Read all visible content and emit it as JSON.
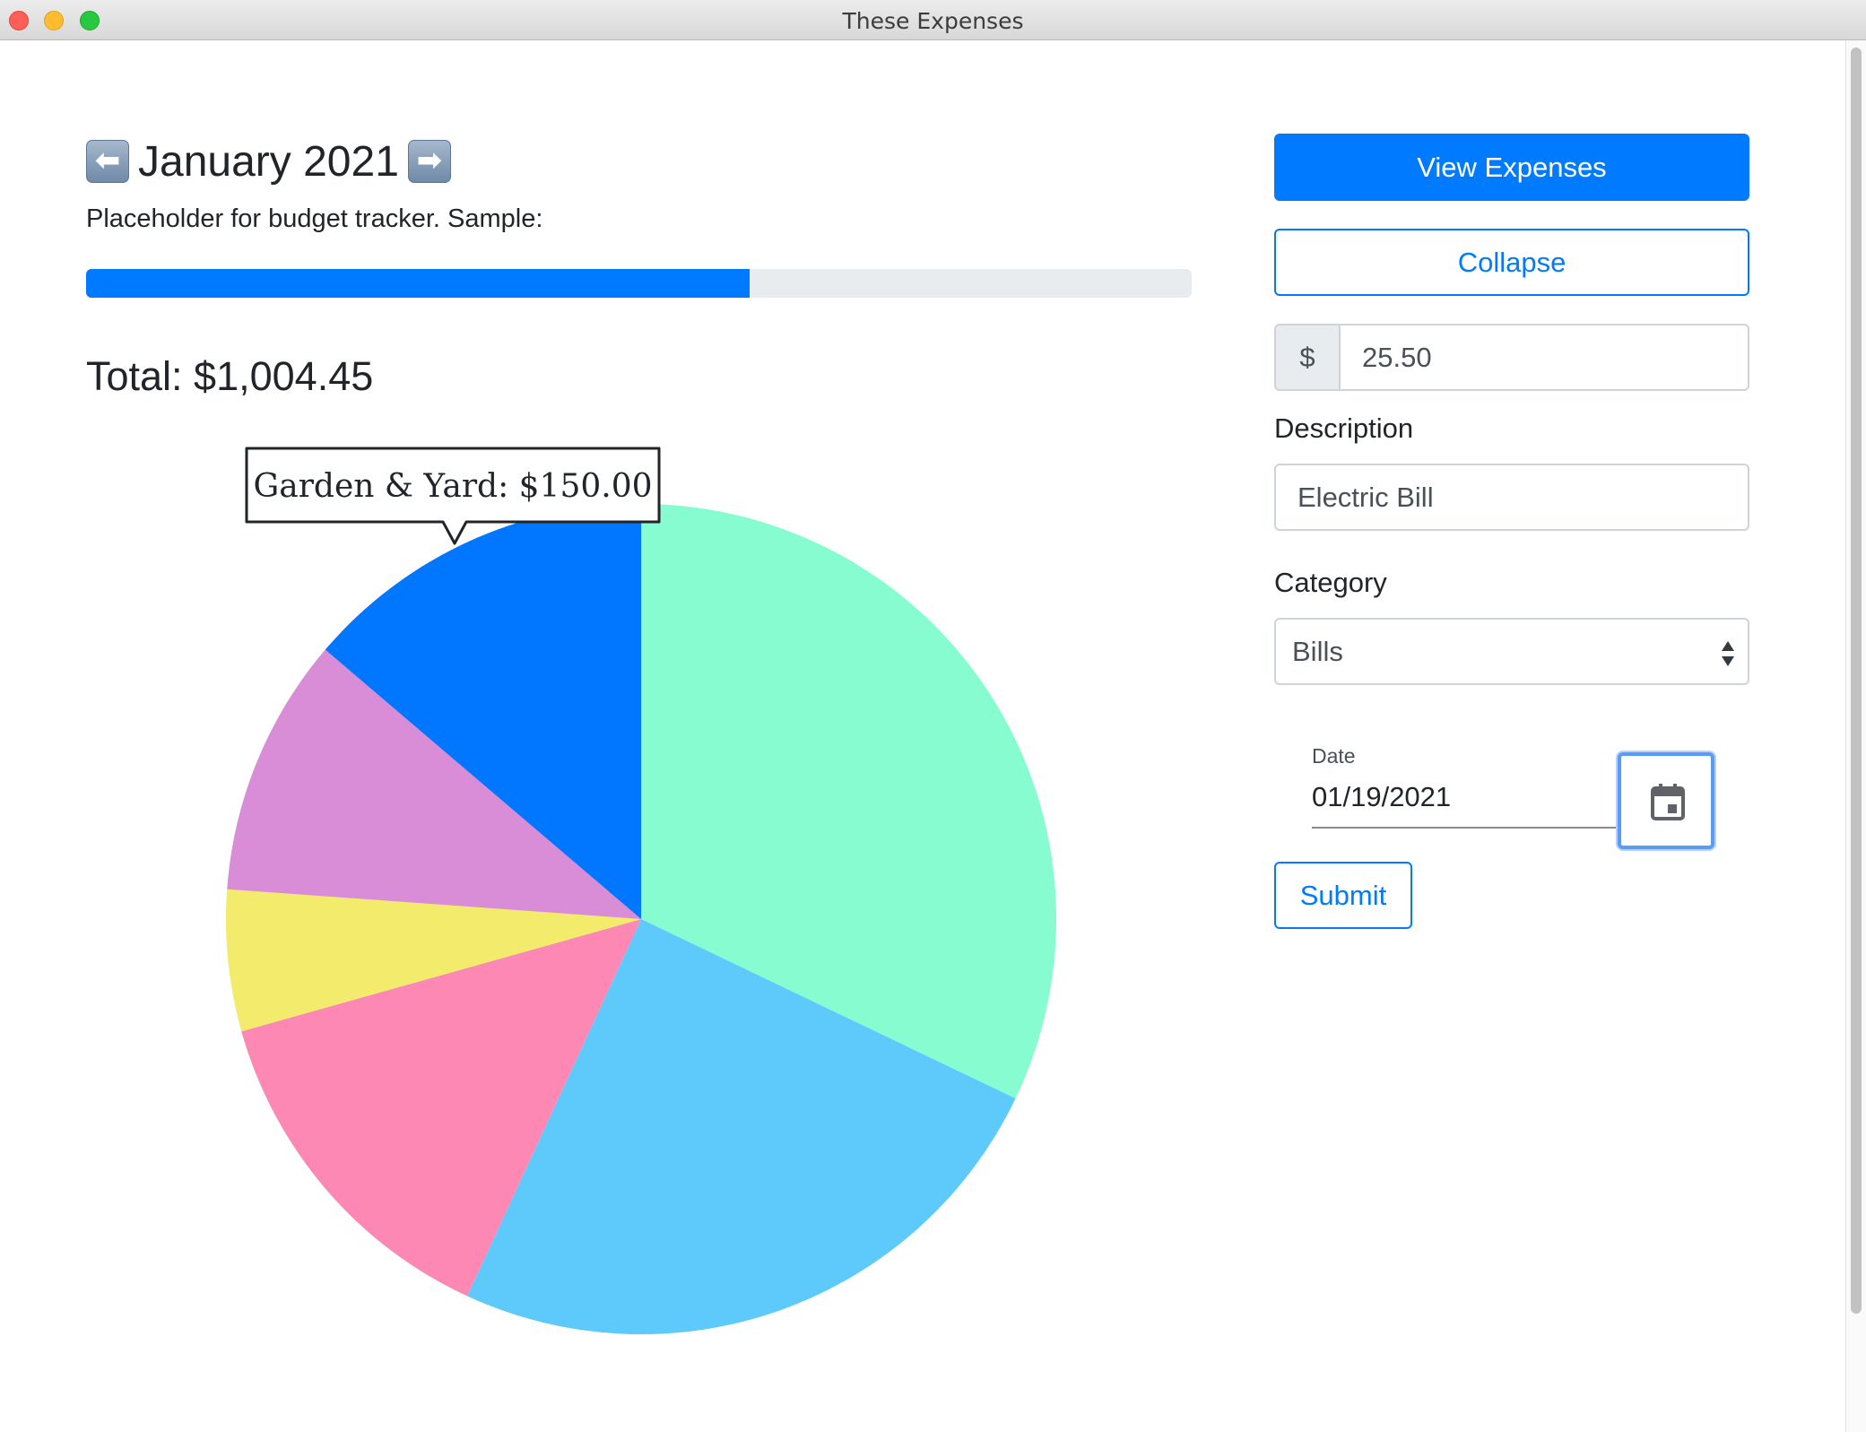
{
  "window": {
    "title": "These Expenses"
  },
  "header": {
    "prev_icon": "left-arrow-icon",
    "next_icon": "right-arrow-icon",
    "prev_glyph": "⬅",
    "next_glyph": "➡",
    "month": "January 2021"
  },
  "budget": {
    "placeholder": "Placeholder for budget tracker. Sample:",
    "progress_percent": 60
  },
  "total": "Total: $1,004.45",
  "chart_data": {
    "type": "pie",
    "slices": [
      {
        "value": 35,
        "color": "#87fcd1"
      },
      {
        "value": 27,
        "color": "#5ecafb"
      },
      {
        "value": 15,
        "color": "#fd88b3"
      },
      {
        "value": 6,
        "color": "#f3eb6b"
      },
      {
        "value": 11,
        "color": "#d88dd6"
      },
      {
        "value": 15,
        "color": "#0177ff"
      }
    ],
    "tooltip": "Garden & Yard: $150.00"
  },
  "form": {
    "view_expenses_label": "View Expenses",
    "collapse_label": "Collapse",
    "currency_symbol": "$",
    "amount_value": "25.50",
    "description_label": "Description",
    "description_value": "Electric Bill",
    "category_label": "Category",
    "category_value": "Bills",
    "date_label": "Date",
    "date_value": "01/19/2021",
    "submit_label": "Submit"
  },
  "colors": {
    "primary": "#007bff",
    "progress_track": "#e9ecef"
  }
}
